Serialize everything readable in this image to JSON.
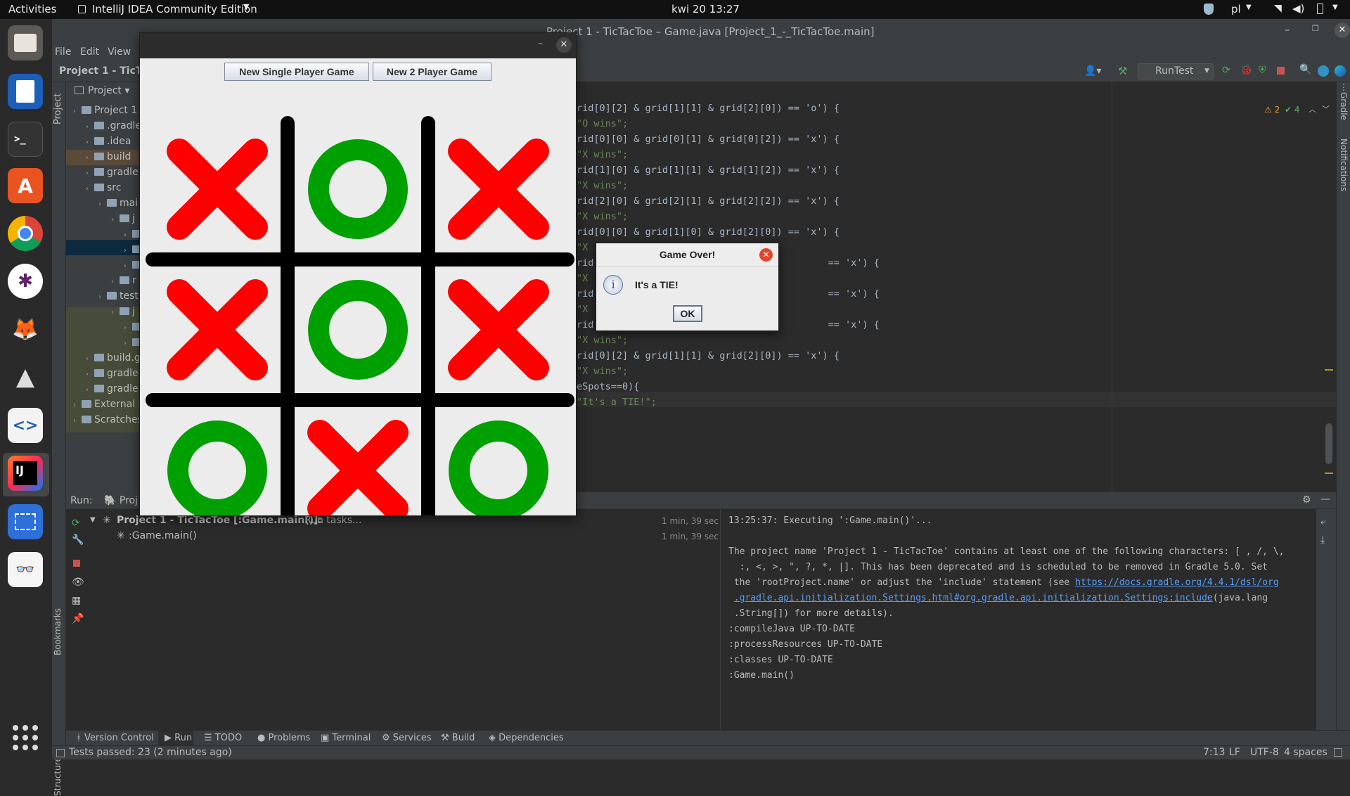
{
  "os": {
    "activities": "Activities",
    "app_menu": "IntelliJ IDEA Community Edition",
    "clock": "kwi 20  13:27",
    "language": "pl"
  },
  "ide": {
    "title": "Project 1 - TicTacToe – Game.java [Project_1_-_TicTacToe.main]",
    "menu": [
      "File",
      "Edit",
      "View"
    ],
    "breadcrumb": "Project 1 - TicTa",
    "run_config": "RunTest",
    "inspections": {
      "warnings": "2",
      "ok": "4"
    },
    "project_view_label": "Project",
    "tree": [
      {
        "label": "Project 1",
        "indent": 0
      },
      {
        "label": ".gradle",
        "indent": 1
      },
      {
        "label": ".idea",
        "indent": 1
      },
      {
        "label": "build",
        "indent": 1
      },
      {
        "label": "gradle",
        "indent": 1
      },
      {
        "label": "src",
        "indent": 1
      },
      {
        "label": "mai",
        "indent": 2
      },
      {
        "label": "j",
        "indent": 3
      },
      {
        "label": "",
        "indent": 4
      },
      {
        "label": "",
        "indent": 4
      },
      {
        "label": "",
        "indent": 4
      },
      {
        "label": "r",
        "indent": 3
      },
      {
        "label": "test",
        "indent": 2
      },
      {
        "label": "j",
        "indent": 3
      },
      {
        "label": "",
        "indent": 4
      },
      {
        "label": "",
        "indent": 4
      },
      {
        "label": "build.g",
        "indent": 1
      },
      {
        "label": "gradle",
        "indent": 1
      },
      {
        "label": "gradle",
        "indent": 1
      },
      {
        "label": "External I",
        "indent": 0
      },
      {
        "label": "Scratches",
        "indent": 0
      }
    ],
    "code_lines": [
      {
        "code": "rid[0][2] & grid[1][1] & grid[2][0]) == 'o') {",
        "kind": "code"
      },
      {
        "code": "\"O wins\";",
        "kind": "str"
      },
      {
        "code": "rid[0][0] & grid[0][1] & grid[0][2]) == 'x') {",
        "kind": "code"
      },
      {
        "code": "\"X wins\";",
        "kind": "str"
      },
      {
        "code": "rid[1][0] & grid[1][1] & grid[1][2]) == 'x') {",
        "kind": "code"
      },
      {
        "code": "\"X wins\";",
        "kind": "str"
      },
      {
        "code": "rid[2][0] & grid[2][1] & grid[2][2]) == 'x') {",
        "kind": "code"
      },
      {
        "code": "\"X wins\";",
        "kind": "str"
      },
      {
        "code": "rid[0][0] & grid[1][0] & grid[2][0]) == 'x') {",
        "kind": "code"
      },
      {
        "code": "\"X",
        "kind": "str"
      },
      {
        "code": "rid                                         == 'x') {",
        "kind": "code"
      },
      {
        "code": "\"X",
        "kind": "str"
      },
      {
        "code": "rid                                         == 'x') {",
        "kind": "code"
      },
      {
        "code": "\"X",
        "kind": "str"
      },
      {
        "code": "rid                                         == 'x') {",
        "kind": "code"
      },
      {
        "code": "\"X wins\";",
        "kind": "str"
      },
      {
        "code": "rid[0][2] & grid[1][1] & grid[2][0]) == 'x') {",
        "kind": "code"
      },
      {
        "code": "\"X wins\";",
        "kind": "str"
      },
      {
        "code": "eSpots==0){",
        "kind": "code"
      },
      {
        "code": "\"It's a TIE!\";",
        "kind": "str"
      }
    ],
    "run": {
      "label": "Run:",
      "tab": "Proj",
      "task_title": "Project 1 - TicTacToe [:Game.main()]:",
      "task_status": "Run tasks...",
      "task_time": "1 min, 39 sec",
      "subtask": ":Game.main()",
      "subtask_time": "1 min, 39 sec",
      "console": [
        {
          "text": "13:25:37: Executing ':Game.main()'...",
          "link": ""
        },
        {
          "text": "",
          "link": ""
        },
        {
          "text": "The project name 'Project 1 - TicTacToe' contains at least one of the following characters: [ , /, \\,",
          "link": ""
        },
        {
          "text": "  :, <, >, \", ?, *, |]. This has been deprecated and is scheduled to be removed in Gradle 5.0. Set",
          "link": ""
        },
        {
          "text": " the 'rootProject.name' or adjust the 'include' statement (see ",
          "link": "https://docs.gradle.org/4.4.1/dsl/org"
        },
        {
          "text": " ",
          "link": ".gradle.api.initialization.Settings.html#org.gradle.api.initialization.Settings:include",
          "after": "(java.lang"
        },
        {
          "text": " .String[]) for more details).",
          "link": ""
        },
        {
          "text": ":compileJava UP-TO-DATE",
          "link": ""
        },
        {
          "text": ":processResources UP-TO-DATE",
          "link": ""
        },
        {
          "text": ":classes UP-TO-DATE",
          "link": ""
        },
        {
          "text": ":Game.main()",
          "link": ""
        }
      ]
    },
    "stripes": {
      "bookmarks": "Bookmarks",
      "structure": "Structure",
      "gradle": "Gradle",
      "notifications": "Notifications"
    },
    "toolwindows": [
      "Version Control",
      "Run",
      "TODO",
      "Problems",
      "Terminal",
      "Services",
      "Build",
      "Dependencies"
    ],
    "status": {
      "message": "Tests passed: 23 (2 minutes ago)",
      "position": "7:13",
      "line_sep": "LF",
      "encoding": "UTF-8",
      "indent": "4 spaces"
    }
  },
  "game": {
    "btn_single": "New Single Player Game",
    "btn_two": "New 2 Player Game",
    "board": [
      "X",
      "O",
      "X",
      "X",
      "O",
      "X",
      "O",
      "X",
      "O"
    ],
    "x_color": "#ff0000",
    "o_color": "#00a000"
  },
  "dialog": {
    "title": "Game Over!",
    "message": "It's a TIE!",
    "ok": "OK"
  }
}
